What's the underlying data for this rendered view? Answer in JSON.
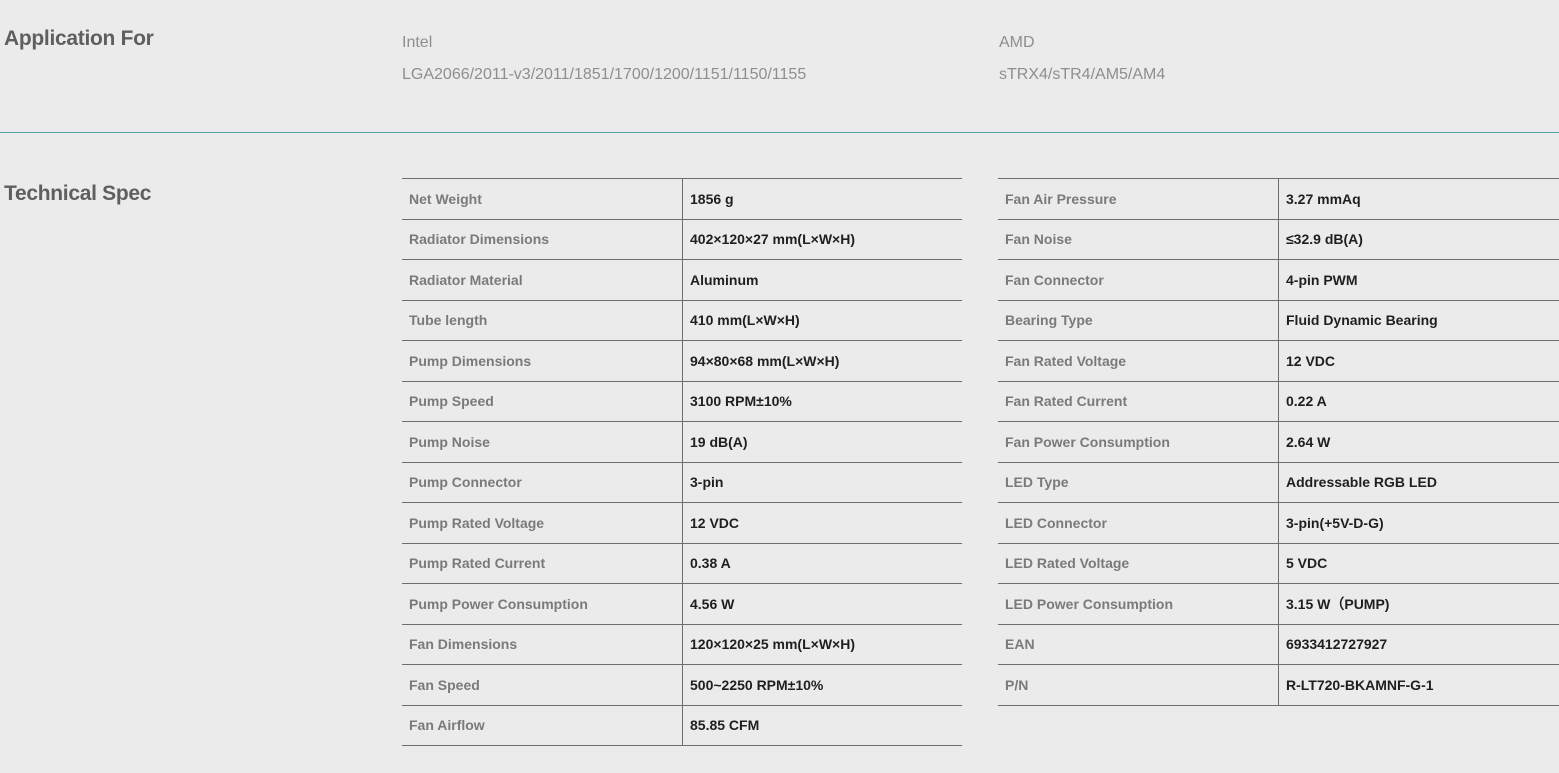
{
  "application": {
    "title": "Application For",
    "intel": {
      "brand": "Intel",
      "sockets": "LGA2066/2011-v3/2011/1851/1700/1200/1151/1150/1155"
    },
    "amd": {
      "brand": "AMD",
      "sockets": "sTRX4/sTR4/AM5/AM4"
    }
  },
  "spec": {
    "title": "Technical Spec",
    "left": [
      {
        "label": "Net Weight",
        "value": "1856 g"
      },
      {
        "label": "Radiator Dimensions",
        "value": "402×120×27 mm(L×W×H)"
      },
      {
        "label": "Radiator Material",
        "value": "Aluminum"
      },
      {
        "label": "Tube length",
        "value": "410 mm(L×W×H)"
      },
      {
        "label": "Pump Dimensions",
        "value": "94×80×68 mm(L×W×H)"
      },
      {
        "label": "Pump Speed",
        "value": "3100 RPM±10%"
      },
      {
        "label": "Pump Noise",
        "value": "19 dB(A)"
      },
      {
        "label": "Pump Connector",
        "value": "3-pin"
      },
      {
        "label": "Pump Rated Voltage",
        "value": "12 VDC"
      },
      {
        "label": "Pump Rated Current",
        "value": "0.38 A"
      },
      {
        "label": "Pump Power Consumption",
        "value": "4.56 W"
      },
      {
        "label": "Fan Dimensions",
        "value": "120×120×25 mm(L×W×H)"
      },
      {
        "label": "Fan Speed",
        "value": "500~2250 RPM±10%"
      },
      {
        "label": "Fan Airflow",
        "value": "85.85 CFM"
      }
    ],
    "right": [
      {
        "label": "Fan Air Pressure",
        "value": "3.27 mmAq"
      },
      {
        "label": "Fan Noise",
        "value": "≤32.9 dB(A)"
      },
      {
        "label": "Fan Connector",
        "value": "4-pin PWM"
      },
      {
        "label": "Bearing Type",
        "value": "Fluid Dynamic Bearing"
      },
      {
        "label": "Fan Rated Voltage",
        "value": "12 VDC"
      },
      {
        "label": "Fan Rated Current",
        "value": "0.22 A"
      },
      {
        "label": "Fan Power Consumption",
        "value": "2.64 W"
      },
      {
        "label": "LED Type",
        "value": "Addressable RGB LED"
      },
      {
        "label": "LED Connector",
        "value": "3-pin(+5V-D-G)"
      },
      {
        "label": "LED Rated Voltage",
        "value": "5 VDC"
      },
      {
        "label": "LED Power Consumption",
        "value": "3.15 W（PUMP)"
      },
      {
        "label": "EAN",
        "value": "6933412727927"
      },
      {
        "label": "P/N",
        "value": "R-LT720-BKAMNF-G-1"
      }
    ]
  }
}
